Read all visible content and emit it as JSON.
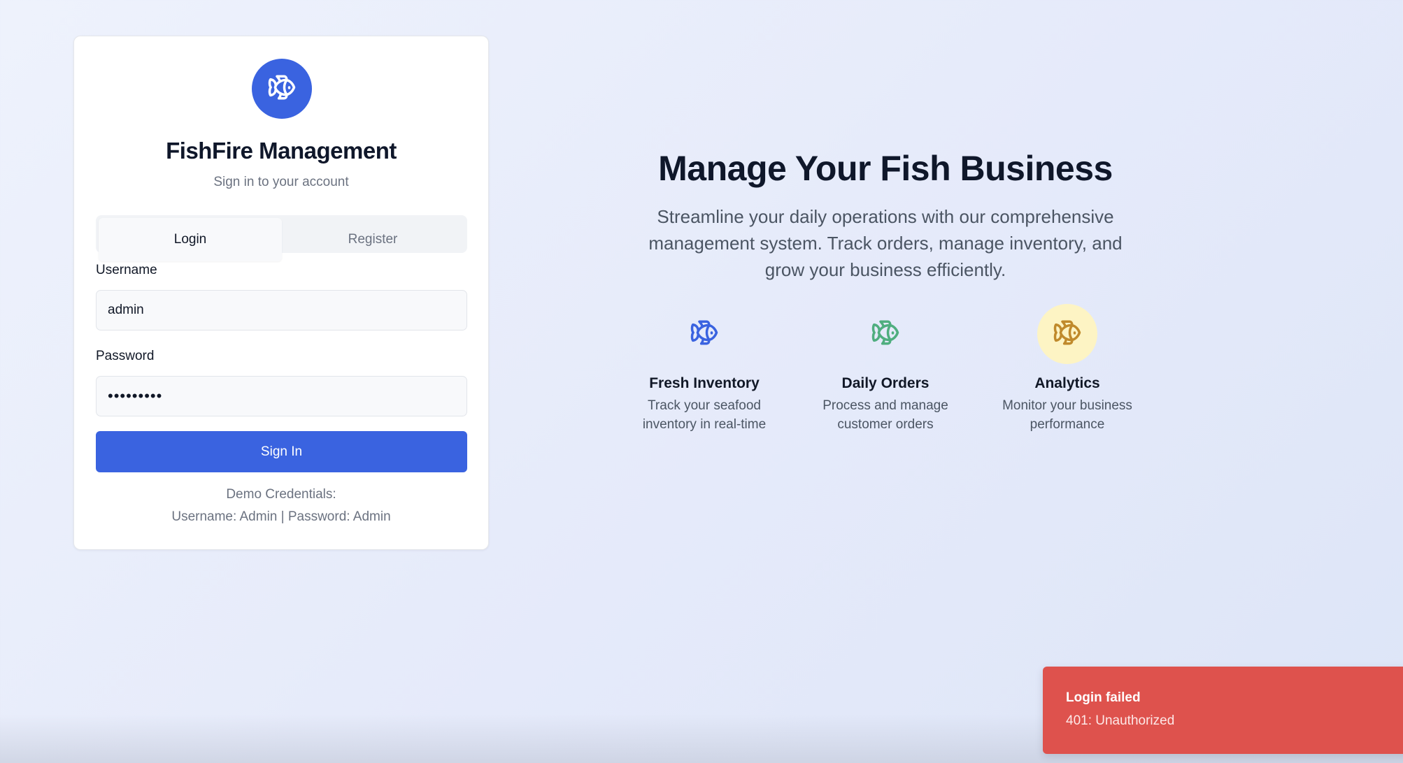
{
  "login_card": {
    "title": "FishFire Management",
    "subtitle": "Sign in to your account",
    "tabs": [
      {
        "label": "Login",
        "active": true
      },
      {
        "label": "Register",
        "active": false
      }
    ],
    "username": {
      "label": "Username",
      "value": "admin"
    },
    "password": {
      "label": "Password",
      "value": "•••••••••"
    },
    "submit_label": "Sign In",
    "demo": {
      "heading": "Demo Credentials:",
      "details": "Username: Admin | Password: Admin"
    },
    "logo_icon": "fish-icon"
  },
  "hero": {
    "title": "Manage Your Fish Business",
    "description": "Streamline your daily operations with our comprehensive management system. Track orders, manage inventory, and grow your business efficiently.",
    "features": [
      {
        "title": "Fresh Inventory",
        "description": "Track your seafood inventory in real-time",
        "icon": "fish-icon",
        "color": "#3a63e0"
      },
      {
        "title": "Daily Orders",
        "description": "Process and manage customer orders",
        "icon": "fish-icon",
        "color": "#4fae7f"
      },
      {
        "title": "Analytics",
        "description": "Monitor your business performance",
        "icon": "fish-icon",
        "color": "#c08a2c"
      }
    ]
  },
  "toast": {
    "title": "Login failed",
    "message": "401: Unauthorized",
    "color": "#de524d"
  },
  "theme": {
    "accent": "#3a63e0",
    "background": "#e8edfb"
  }
}
